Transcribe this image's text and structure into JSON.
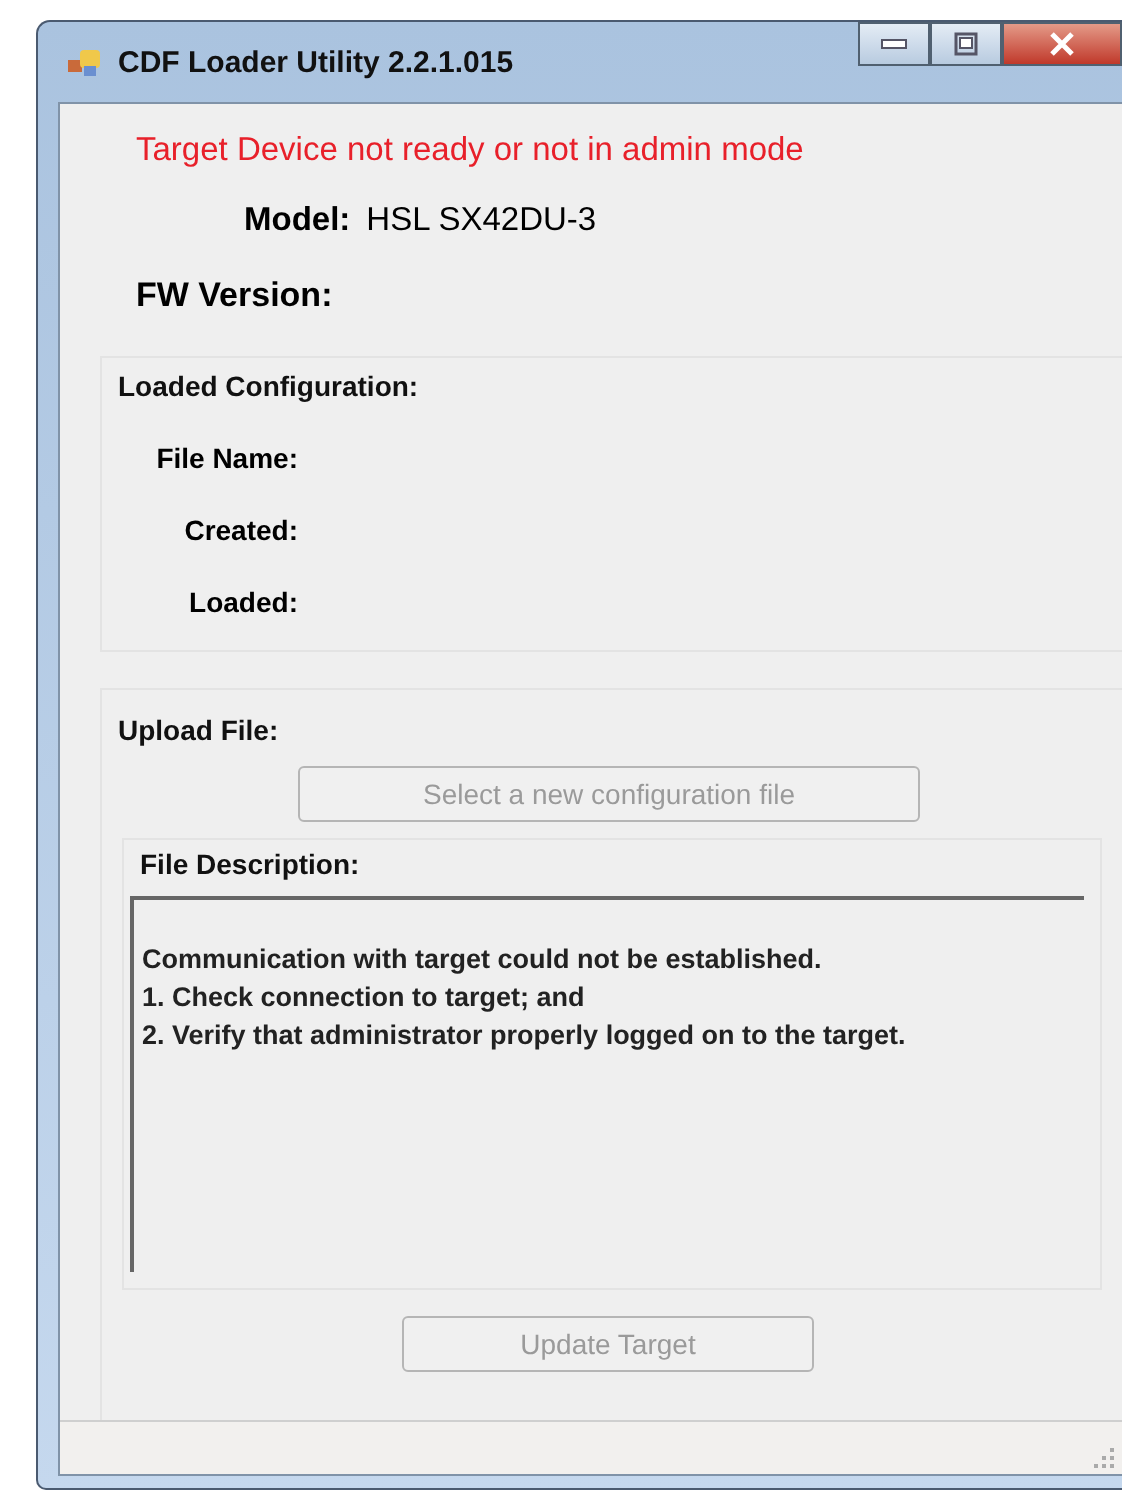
{
  "window": {
    "title": "CDF Loader Utility 2.2.1.015"
  },
  "status_message": "Target Device not ready or not in admin mode",
  "model": {
    "label": "Model:",
    "value": "HSL SX42DU-3"
  },
  "fw_version": {
    "label": "FW Version:"
  },
  "loaded_configuration": {
    "title": "Loaded Configuration:",
    "fields": [
      {
        "label": "File Name:"
      },
      {
        "label": "Created:"
      },
      {
        "label": "Loaded:"
      }
    ]
  },
  "upload_file": {
    "title": "Upload File:",
    "select_button": {
      "label": "Select a new configuration file",
      "disabled": true
    },
    "file_description": {
      "title": "File Description:",
      "lines": [
        "Communication with target could not be established.",
        "1. Check connection to target; and",
        "2. Verify that administrator properly logged on to the target."
      ]
    }
  },
  "update_button": {
    "label": "Update Target",
    "disabled": true
  }
}
